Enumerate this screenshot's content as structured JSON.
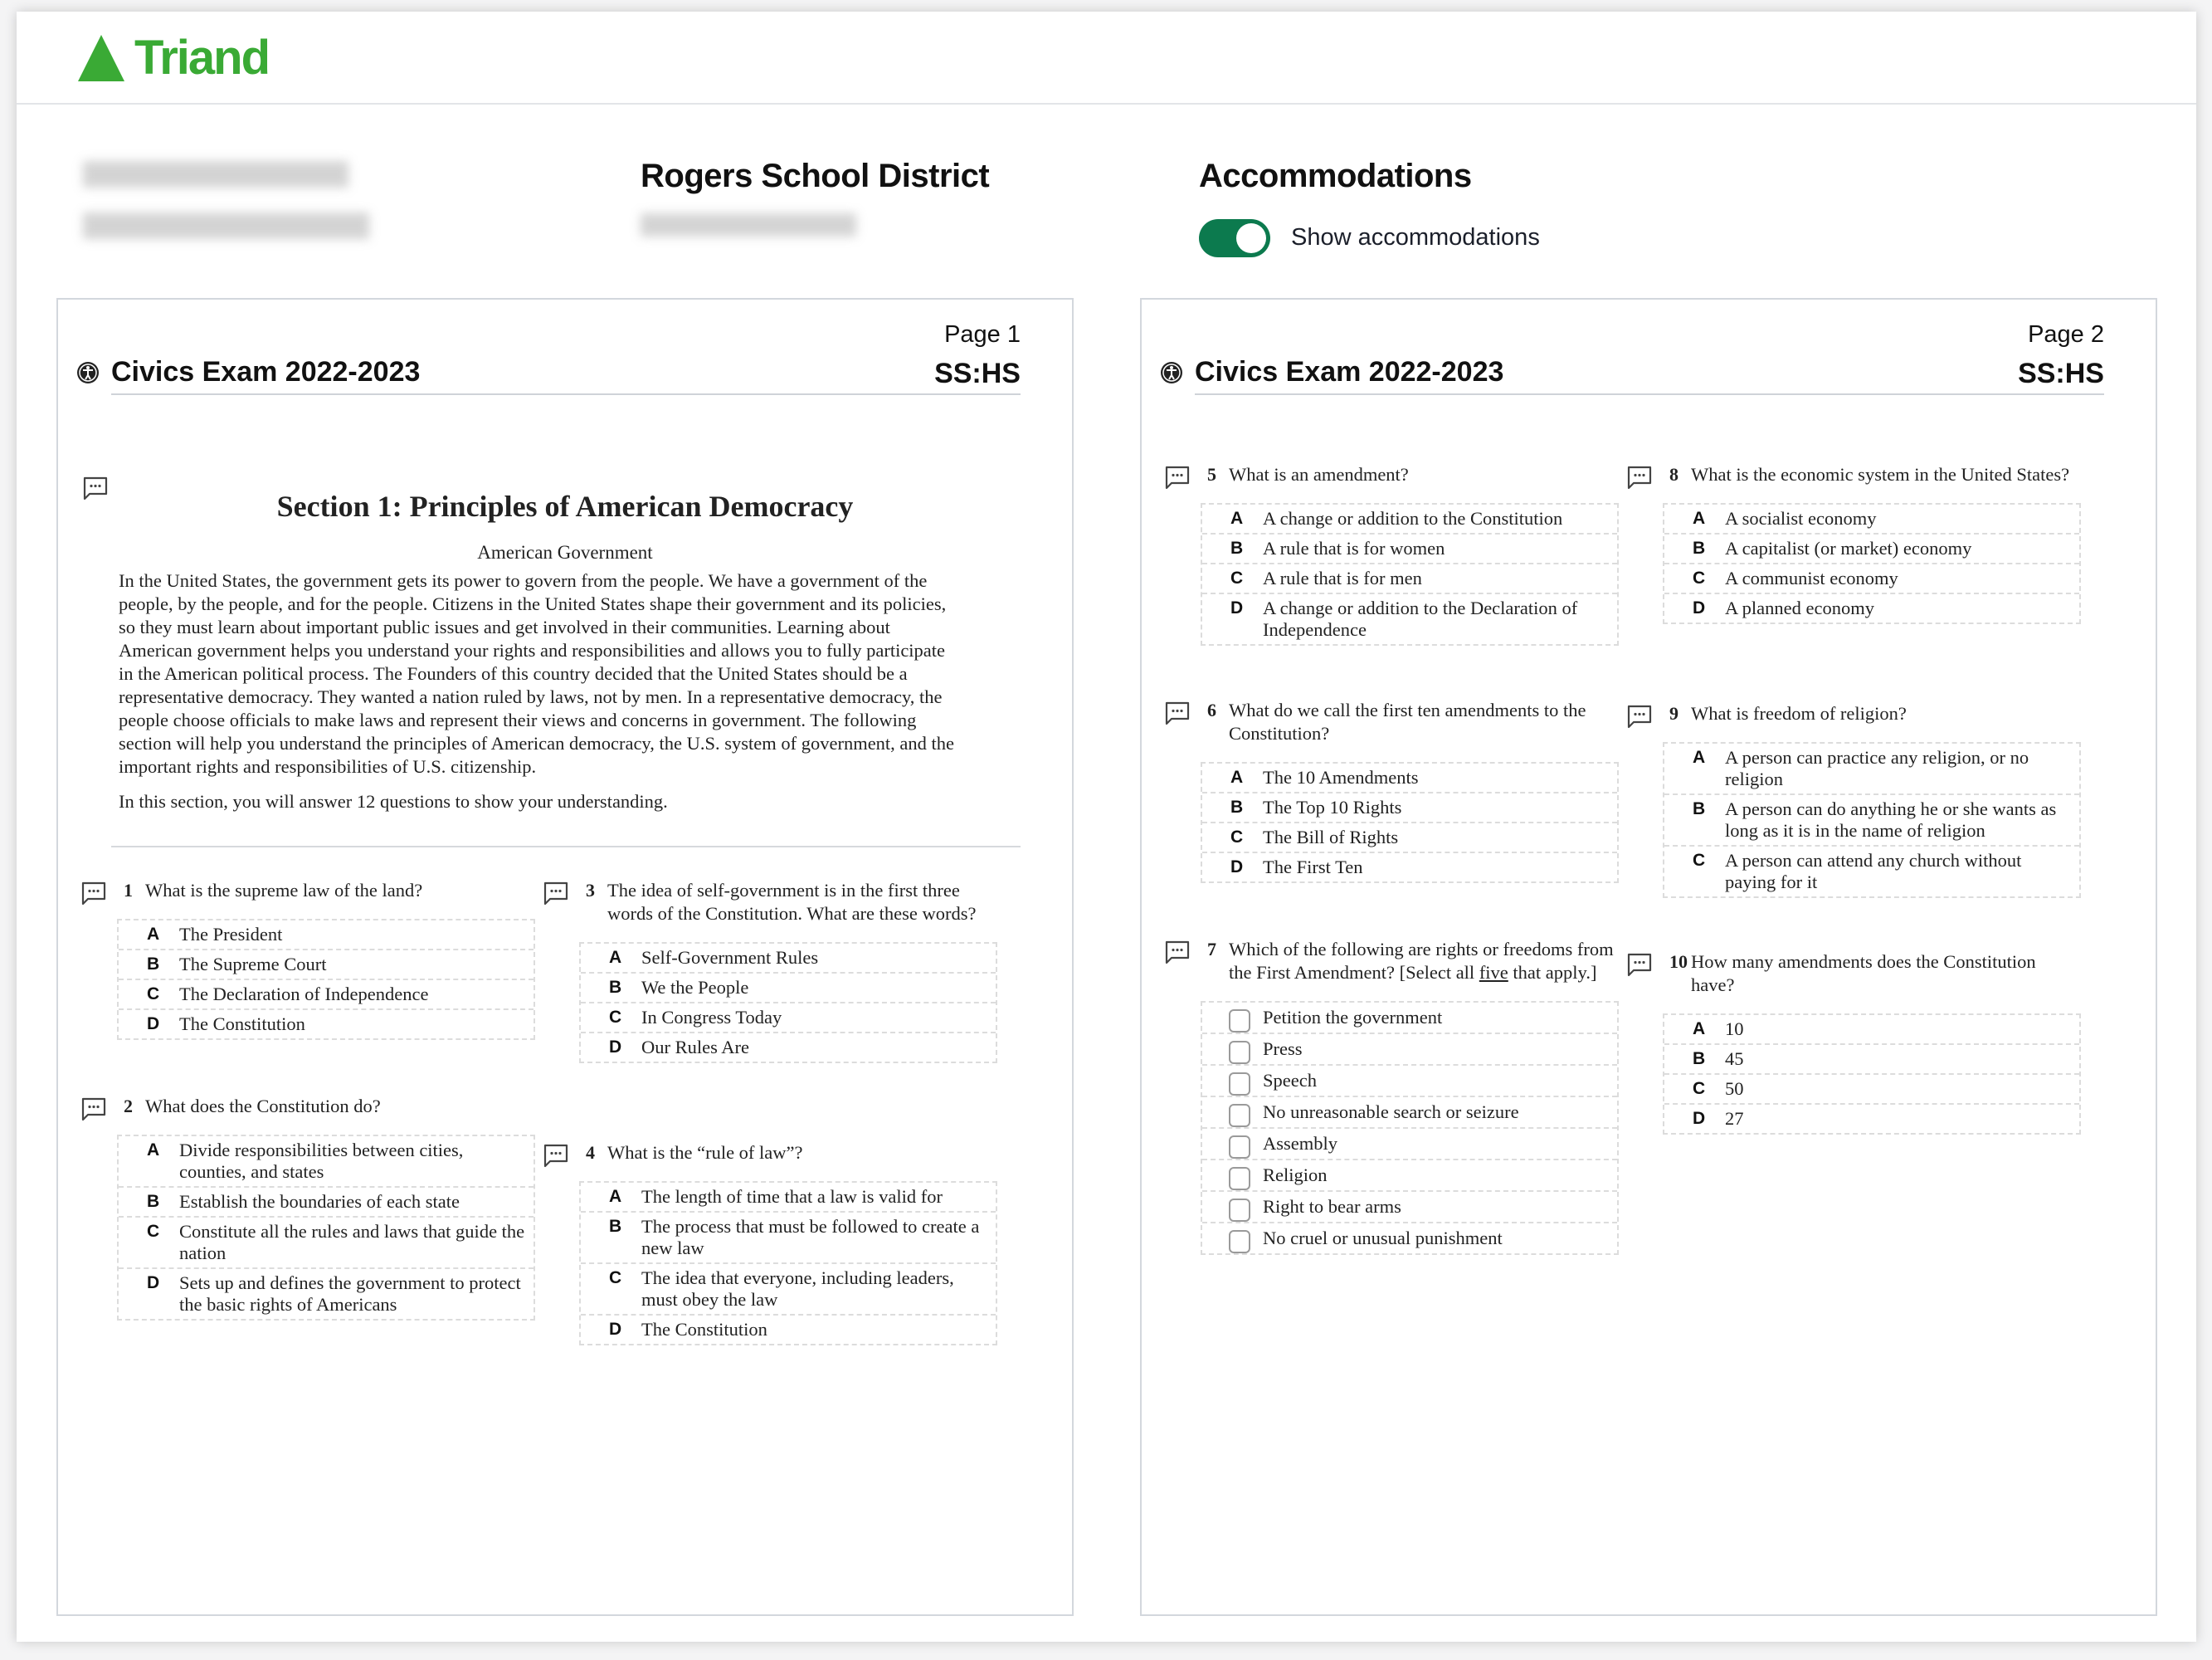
{
  "brand": {
    "name": "Triand",
    "color": "#3aaa35"
  },
  "header": {
    "district": "Rogers School District",
    "accommodations_title": "Accommodations",
    "toggle_label": "Show accommodations",
    "toggle_on": true,
    "toggle_color": "#0c7a4e"
  },
  "pages": [
    {
      "page_label": "Page 1",
      "exam_title": "Civics Exam 2022-2023",
      "subject": "SS:HS",
      "section": {
        "title": "Section 1: Principles of American Democracy",
        "subtitle": "American Government",
        "paragraph_lines": [
          "In the United States, the government gets its power to govern from the people. We have a government of the",
          "people, by the people, and for the people. Citizens in the United States shape their government and its policies,",
          "so they must learn about important public issues and get involved in their communities. Learning about",
          "American government helps you understand your rights and responsibilities and allows you to fully participate",
          "in the American political process. The Founders of this country decided that the United States should be a",
          "representative democracy. They wanted a nation ruled by laws, not by men. In a representative democracy, the",
          "people choose officials to make laws and represent their views and concerns in government. The following",
          "section will help you understand the principles of American democracy, the U.S. system of government, and the",
          "important rights and responsibilities of U.S. citizenship."
        ],
        "closing": "In this section, you will answer 12 questions to show your understanding."
      }
    },
    {
      "page_label": "Page 2",
      "exam_title": "Civics Exam 2022-2023",
      "subject": "SS:HS"
    }
  ],
  "questions": [
    {
      "number": "1",
      "text": "What is the supreme law of the land?",
      "type": "single",
      "options": [
        {
          "letter": "A",
          "text": "The President"
        },
        {
          "letter": "B",
          "text": "The Supreme Court"
        },
        {
          "letter": "C",
          "text": "The Declaration of Independence"
        },
        {
          "letter": "D",
          "text": "The Constitution"
        }
      ]
    },
    {
      "number": "2",
      "text": "What does the Constitution do?",
      "type": "single",
      "options": [
        {
          "letter": "A",
          "text": "Divide responsibilities between cities, counties, and states"
        },
        {
          "letter": "B",
          "text": "Establish the boundaries of each state"
        },
        {
          "letter": "C",
          "text": "Constitute all the rules and laws that guide the nation"
        },
        {
          "letter": "D",
          "text": "Sets up and defines the government to protect the basic rights of Americans"
        }
      ]
    },
    {
      "number": "3",
      "text": "The idea of self-government is in the first three words of the Constitution. What are these words?",
      "type": "single",
      "options": [
        {
          "letter": "A",
          "text": "Self-Government Rules"
        },
        {
          "letter": "B",
          "text": "We the People"
        },
        {
          "letter": "C",
          "text": "In Congress Today"
        },
        {
          "letter": "D",
          "text": "Our Rules Are"
        }
      ]
    },
    {
      "number": "4",
      "text": "What is the “rule of law”?",
      "type": "single",
      "options": [
        {
          "letter": "A",
          "text": "The length of time that a law is valid for"
        },
        {
          "letter": "B",
          "text": "The process that must be followed to create a new law"
        },
        {
          "letter": "C",
          "text": "The idea that everyone, including leaders, must obey the law"
        },
        {
          "letter": "D",
          "text": "The Constitution"
        }
      ]
    },
    {
      "number": "5",
      "text": "What is an amendment?",
      "type": "single",
      "options": [
        {
          "letter": "A",
          "text": "A change or addition to the Constitution"
        },
        {
          "letter": "B",
          "text": "A rule that is for women"
        },
        {
          "letter": "C",
          "text": "A rule that is for men"
        },
        {
          "letter": "D",
          "text": "A change or addition to the Declaration of Independence"
        }
      ]
    },
    {
      "number": "6",
      "text": "What do we call the first ten amendments to the Constitution?",
      "type": "single",
      "options": [
        {
          "letter": "A",
          "text": "The 10 Amendments"
        },
        {
          "letter": "B",
          "text": "The Top 10 Rights"
        },
        {
          "letter": "C",
          "text": "The Bill of Rights"
        },
        {
          "letter": "D",
          "text": "The First Ten"
        }
      ]
    },
    {
      "number": "7",
      "text": "Which of the following are rights or freedoms from the First Amendment? [Select all ",
      "text_underlined": "five",
      "text_after": " that apply.]",
      "type": "multi",
      "options": [
        {
          "text": "Petition the government"
        },
        {
          "text": "Press"
        },
        {
          "text": "Speech"
        },
        {
          "text": "No unreasonable search or seizure"
        },
        {
          "text": "Assembly"
        },
        {
          "text": "Religion"
        },
        {
          "text": "Right to bear arms"
        },
        {
          "text": "No cruel or unusual punishment"
        }
      ]
    },
    {
      "number": "8",
      "text": "What is the economic system in the United States?",
      "type": "single",
      "options": [
        {
          "letter": "A",
          "text": "A socialist economy"
        },
        {
          "letter": "B",
          "text": "A capitalist (or market) economy"
        },
        {
          "letter": "C",
          "text": "A communist economy"
        },
        {
          "letter": "D",
          "text": "A planned economy"
        }
      ]
    },
    {
      "number": "9",
      "text": "What is freedom of religion?",
      "type": "single",
      "options": [
        {
          "letter": "A",
          "text": "A person can practice any religion, or no religion"
        },
        {
          "letter": "B",
          "text": "A person can do anything he or she wants as long as it is in the name of religion"
        },
        {
          "letter": "C",
          "text": "A person can attend any church without paying for it"
        }
      ]
    },
    {
      "number": "10",
      "text": "How many amendments does the Constitution have?",
      "type": "single",
      "options": [
        {
          "letter": "A",
          "text": "10"
        },
        {
          "letter": "B",
          "text": "45"
        },
        {
          "letter": "C",
          "text": "50"
        },
        {
          "letter": "D",
          "text": "27"
        }
      ]
    }
  ]
}
